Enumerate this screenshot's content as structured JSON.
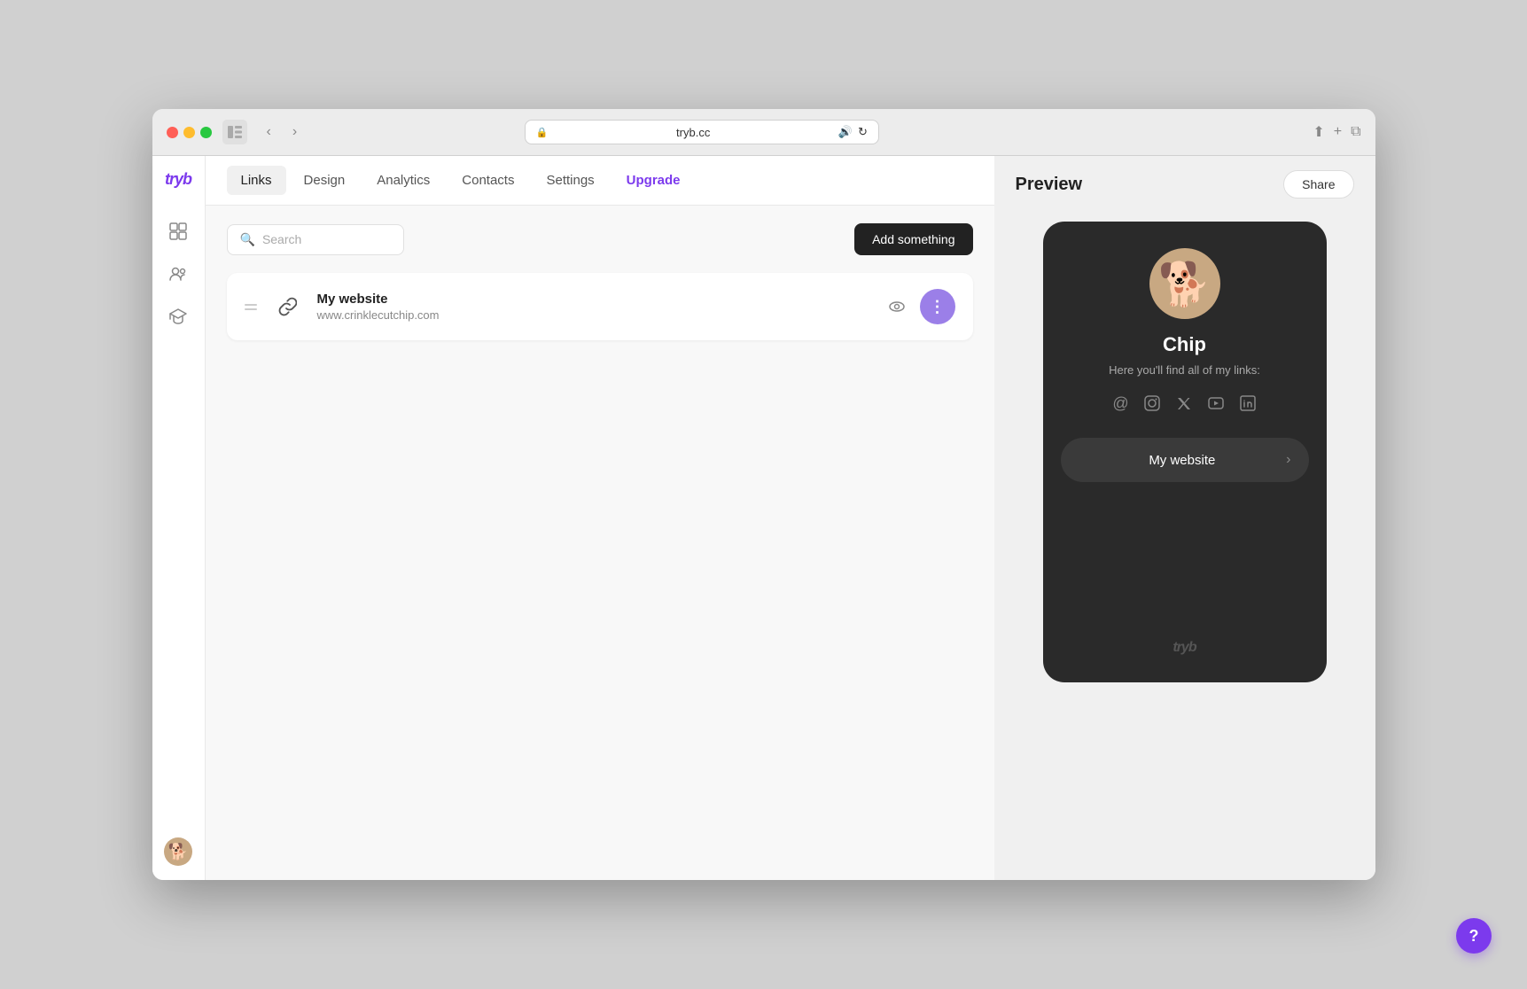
{
  "browser": {
    "url": "tryb.cc",
    "audio_icon": "🔊",
    "refresh_icon": "↻"
  },
  "logo": {
    "text": "tryb"
  },
  "nav": {
    "tabs": [
      {
        "id": "links",
        "label": "Links",
        "active": true
      },
      {
        "id": "design",
        "label": "Design",
        "active": false
      },
      {
        "id": "analytics",
        "label": "Analytics",
        "active": false
      },
      {
        "id": "contacts",
        "label": "Contacts",
        "active": false
      },
      {
        "id": "settings",
        "label": "Settings",
        "active": false
      },
      {
        "id": "upgrade",
        "label": "Upgrade",
        "active": false,
        "highlight": true
      }
    ]
  },
  "toolbar": {
    "search_placeholder": "Search",
    "add_button_label": "Add something"
  },
  "links": [
    {
      "title": "My website",
      "url": "www.crinklecutchip.com"
    }
  ],
  "preview": {
    "title": "Preview",
    "share_label": "Share",
    "profile": {
      "name": "Chip",
      "bio": "Here you'll find all of my links:",
      "avatar_emoji": "🐕"
    },
    "social_icons": [
      "@",
      "📷",
      "🐦",
      "▶",
      "in"
    ],
    "link_buttons": [
      {
        "label": "My website",
        "arrow": "›"
      }
    ],
    "watermark": "tryb"
  },
  "help": {
    "label": "?"
  }
}
